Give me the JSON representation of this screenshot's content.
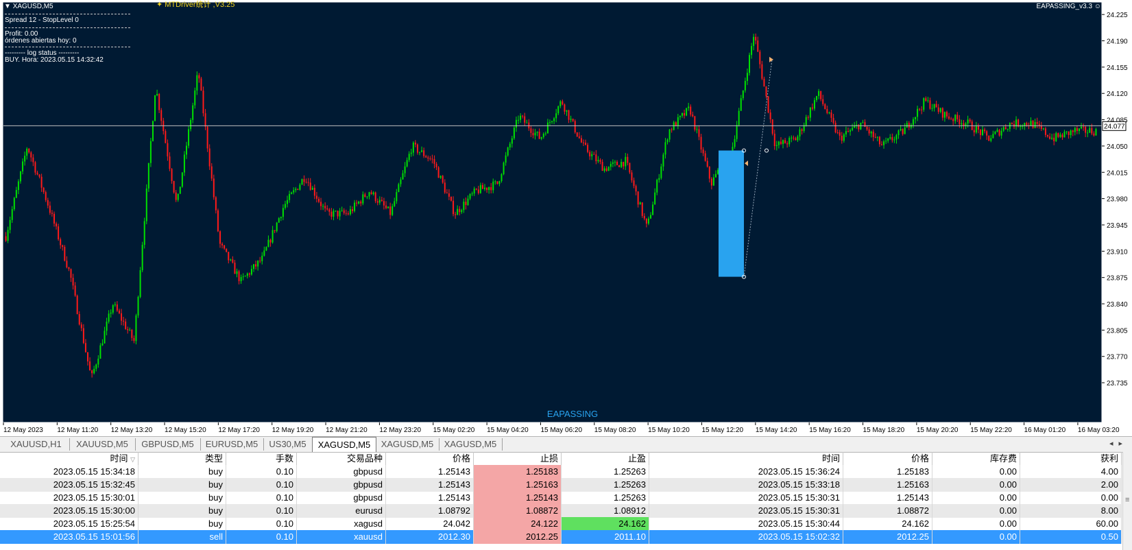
{
  "chart": {
    "title": "XAGUSD,M5",
    "indicator_title": "MTDriver统计 ,V3.25",
    "ea_label": "EAPASSING_v3.3 ☺",
    "watermark": "EAPASSING",
    "current_price": "24.077",
    "info": {
      "spread": "Spread 12 - StopLevel 0",
      "profit": "Profit: 0.00",
      "open_orders": "órdenes abiertas hoy: 0",
      "log_status": "--------- log status ---------",
      "log_entry": "BUY. Hora: 2023.05.15 14:32:42"
    },
    "colors": {
      "background": "#001a33",
      "bull": "#00e000",
      "bear": "#ff1a1a",
      "highlight_box": "#29a3ef"
    }
  },
  "chart_data": {
    "type": "candlestick",
    "symbol": "XAGUSD",
    "timeframe": "M5",
    "y_ticks": [
      "24.225",
      "24.190",
      "24.155",
      "24.120",
      "24.085",
      "24.050",
      "24.015",
      "23.980",
      "23.945",
      "23.910",
      "23.875",
      "23.840",
      "23.805",
      "23.770",
      "23.735"
    ],
    "ylim": [
      23.715,
      24.237
    ],
    "x_ticks": [
      "12 May 2023",
      "12 May 11:20",
      "12 May 13:20",
      "12 May 15:20",
      "12 May 17:20",
      "12 May 19:20",
      "12 May 21:20",
      "12 May 23:20",
      "15 May 02:20",
      "15 May 04:20",
      "15 May 06:20",
      "15 May 08:20",
      "15 May 10:20",
      "15 May 12:20",
      "15 May 14:20",
      "15 May 16:20",
      "15 May 18:20",
      "15 May 20:20",
      "15 May 22:20",
      "16 May 01:20",
      "16 May 03:20"
    ],
    "close_path": [
      23.93,
      24.05,
      23.97,
      23.88,
      23.74,
      23.84,
      23.79,
      24.13,
      23.97,
      24.15,
      23.92,
      23.87,
      23.9,
      23.97,
      24.01,
      23.96,
      23.96,
      23.99,
      23.96,
      24.05,
      24.03,
      23.96,
      23.99,
      24.0,
      24.09,
      24.06,
      24.11,
      24.05,
      24.02,
      24.03,
      23.94,
      24.07,
      24.1,
      24.0,
      24.05,
      24.2,
      24.05,
      24.06,
      24.12,
      24.06,
      24.08,
      24.05,
      24.07,
      24.11,
      24.09,
      24.08,
      24.06,
      24.08,
      24.08,
      24.06,
      24.07,
      24.07
    ],
    "current_price": 24.077,
    "annotations": {
      "entry_box": {
        "price_top": 24.044,
        "price_bottom": 23.876
      }
    }
  },
  "tabs": [
    "XAUUSD,H1",
    "XAUUSD,M5",
    "GBPUSD,M5",
    "EURUSD,M5",
    "US30,M5",
    "XAGUSD,M5",
    "XAGUSD,M5",
    "XAGUSD,M5"
  ],
  "active_tab_index": 5,
  "table": {
    "headers": [
      "时间",
      "类型",
      "手数",
      "交易品种",
      "价格",
      "止损",
      "止盈",
      "时间",
      "价格",
      "库存费",
      "获利"
    ],
    "rows": [
      [
        "2023.05.15 15:34:18",
        "buy",
        "0.10",
        "gbpusd",
        "1.25143",
        "1.25183",
        "1.25263",
        "2023.05.15 15:36:24",
        "1.25183",
        "0.00",
        "4.00"
      ],
      [
        "2023.05.15 15:32:45",
        "buy",
        "0.10",
        "gbpusd",
        "1.25143",
        "1.25163",
        "1.25263",
        "2023.05.15 15:33:18",
        "1.25163",
        "0.00",
        "2.00"
      ],
      [
        "2023.05.15 15:30:01",
        "buy",
        "0.10",
        "gbpusd",
        "1.25143",
        "1.25143",
        "1.25263",
        "2023.05.15 15:30:31",
        "1.25143",
        "0.00",
        "0.00"
      ],
      [
        "2023.05.15 15:30:00",
        "buy",
        "0.10",
        "eurusd",
        "1.08792",
        "1.08872",
        "1.08912",
        "2023.05.15 15:30:31",
        "1.08872",
        "0.00",
        "8.00"
      ],
      [
        "2023.05.15 15:25:54",
        "buy",
        "0.10",
        "xagusd",
        "24.042",
        "24.122",
        "24.162",
        "2023.05.15 15:30:44",
        "24.162",
        "0.00",
        "60.00"
      ],
      [
        "2023.05.15 15:01:56",
        "sell",
        "0.10",
        "xauusd",
        "2012.30",
        "2012.25",
        "2011.10",
        "2023.05.15 15:02:32",
        "2012.25",
        "0.00",
        "0.50"
      ]
    ],
    "selected_row_index": 5
  }
}
